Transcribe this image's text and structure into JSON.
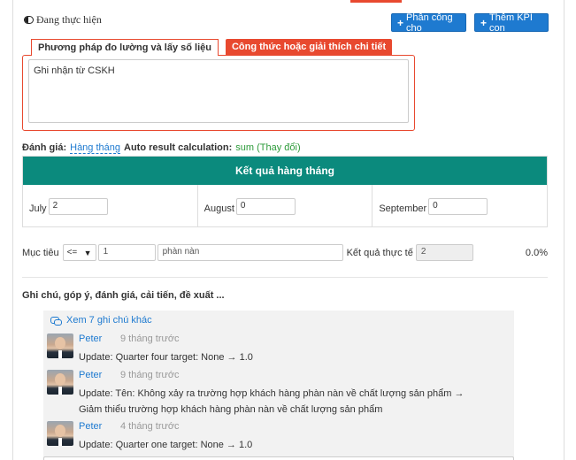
{
  "status": {
    "label": "Đang thực hiện"
  },
  "buttons": {
    "assign": "Phân công cho",
    "add_kpi": "Thêm KPI con"
  },
  "tabs": [
    {
      "label": "Phương pháp đo lường và lấy số liệu",
      "active": true
    },
    {
      "label": "Công thức hoặc giải thích chi tiết",
      "active": false
    }
  ],
  "method": {
    "text": "Ghi nhận từ CSKH"
  },
  "evaluation": {
    "label": "Đánh giá:",
    "frequency": "Hàng tháng",
    "calc_label": "Auto result calculation:",
    "calc_value": "sum (Thay đổi)"
  },
  "monthly": {
    "title": "Kết quả hàng tháng",
    "months": [
      {
        "name": "July",
        "value": "2"
      },
      {
        "name": "August",
        "value": "0"
      },
      {
        "name": "September",
        "value": "0"
      }
    ]
  },
  "target": {
    "label": "Mục tiêu",
    "operator": "<=",
    "value": "1",
    "unit": "phàn nàn",
    "actual_label": "Kết quả thực tế",
    "actual_value": "2",
    "percent": "0.0%"
  },
  "notes": {
    "title": "Ghi chú, góp ý, đánh giá, cải tiến, đề xuất ...",
    "see_more": "Xem 7 ghi chú khác",
    "comments": [
      {
        "author": "Peter",
        "time": "9 tháng trước",
        "text": "Update: Quarter four target: None → 1.0"
      },
      {
        "author": "Peter",
        "time": "9 tháng trước",
        "text": "Update: Tên: Không xảy ra trường hợp khách hàng phàn nàn về chất lượng sản phẩm → Giảm thiểu trường hợp khách hàng phàn nàn về chất lượng sản phẩm"
      },
      {
        "author": "Peter",
        "time": "4 tháng trước",
        "text": "Update: Quarter one target: None → 1.0"
      }
    ]
  },
  "colors": {
    "accent": "#e8492f",
    "primary": "#1e7ad0",
    "teal": "#0b8a7d",
    "green": "#2d9b3a"
  }
}
